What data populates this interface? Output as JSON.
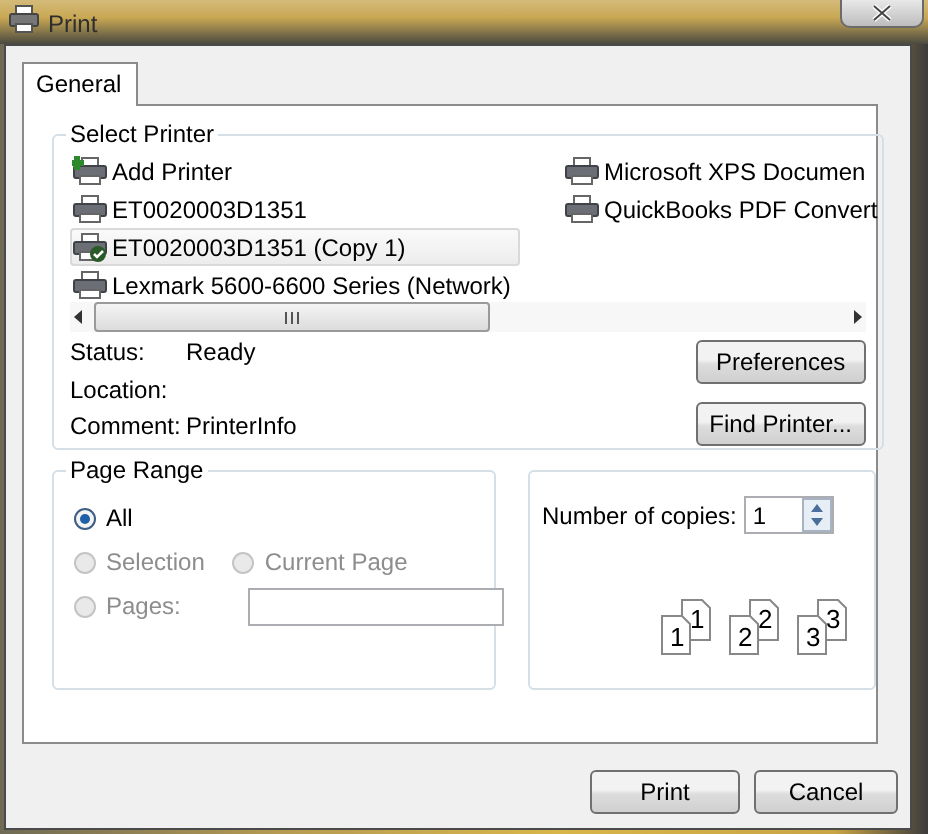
{
  "window": {
    "title": "Print"
  },
  "tabs": [
    {
      "label": "General",
      "selected": true
    }
  ],
  "select_printer": {
    "title": "Select Printer",
    "printers": [
      {
        "name": "Add Printer",
        "kind": "add",
        "selected": false,
        "default": false
      },
      {
        "name": "ET0020003D1351",
        "kind": "printer",
        "selected": false,
        "default": false
      },
      {
        "name": "ET0020003D1351 (Copy 1)",
        "kind": "printer",
        "selected": true,
        "default": true
      },
      {
        "name": "Lexmark 5600-6600 Series (Network)",
        "kind": "printer",
        "selected": false,
        "default": false
      },
      {
        "name": "Microsoft XPS Documen",
        "kind": "printer",
        "selected": false,
        "default": false
      },
      {
        "name": "QuickBooks PDF Convert",
        "kind": "printer",
        "selected": false,
        "default": false
      }
    ],
    "info": [
      {
        "label": "Status:",
        "value": "Ready"
      },
      {
        "label": "Location:"
      },
      {
        "label": "Comment:",
        "value": "PrinterInfo"
      }
    ],
    "buttons": [
      "Preferences",
      "Find Printer..."
    ]
  },
  "page_range": {
    "title": "Page Range",
    "options": [
      {
        "label": "All",
        "selected": true,
        "disabled": false
      },
      {
        "label": "Selection",
        "selected": false,
        "disabled": true
      },
      {
        "label": "Current Page",
        "selected": false,
        "disabled": true
      },
      {
        "label": "Pages:",
        "selected": false,
        "disabled": true
      }
    ]
  },
  "copies": {
    "label": "Number of copies:",
    "value": "1",
    "collate_pages": [
      {
        "front": "1",
        "back": "1"
      },
      {
        "front": "2",
        "back": "2"
      },
      {
        "front": "3",
        "back": "3"
      }
    ]
  },
  "buttons": [
    "Print",
    "Cancel"
  ]
}
